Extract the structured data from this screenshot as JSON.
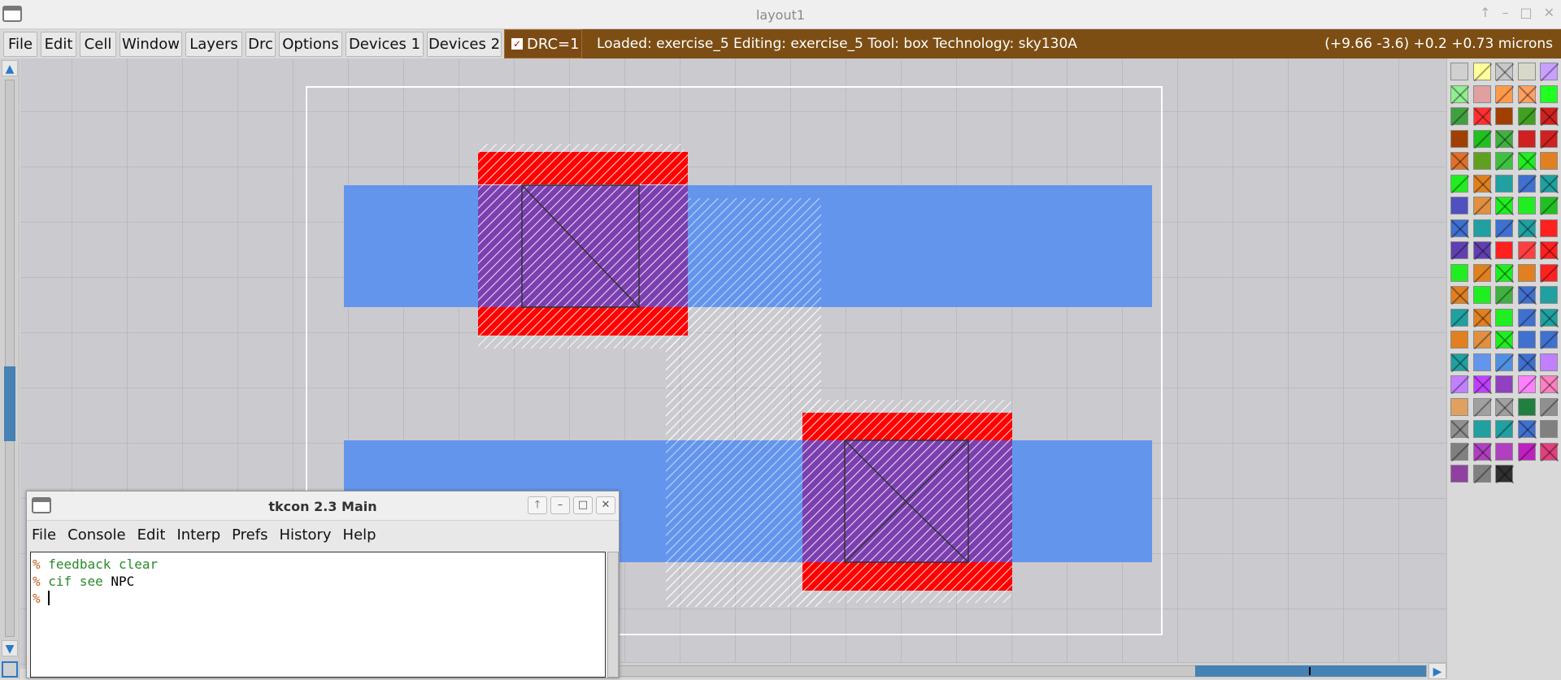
{
  "window": {
    "title": "layout1",
    "controls": [
      "↑",
      "–",
      "□",
      "✕"
    ]
  },
  "menubar": {
    "items": [
      "File",
      "Edit",
      "Cell",
      "Window",
      "Layers",
      "Drc",
      "Options",
      "Devices 1",
      "Devices 2"
    ]
  },
  "drc": {
    "label": "DRC=1",
    "checked": true
  },
  "status": {
    "text": "Loaded: exercise_5 Editing: exercise_5 Tool: box  Technology: sky130A",
    "coords": "(+9.66 -3.6) +0.2 +0.73 microns"
  },
  "canvas": {
    "colors": {
      "background": "#cacacf",
      "grid": "#a9a9b0",
      "metal_blue": "#6495ed",
      "poly_red": "#ff0000",
      "contact": "#6a3fa8",
      "outline": "#ffffff"
    }
  },
  "tkcon": {
    "title": "tkcon 2.3 Main",
    "controls": [
      "🡑",
      "–",
      "□",
      "✕"
    ],
    "menu": [
      "File",
      "Console",
      "Edit",
      "Interp",
      "Prefs",
      "History",
      "Help"
    ],
    "lines": [
      {
        "prompt": "%",
        "cmd": "feedback clear",
        "arg": ""
      },
      {
        "prompt": "%",
        "cmd": "cif see",
        "arg": "NPC"
      },
      {
        "prompt": "%",
        "cmd": "",
        "arg": ""
      }
    ]
  },
  "palette": {
    "icon": "layer-palette",
    "swatches": [
      "#d0d0d0",
      "#ffff9c",
      "#c8c8c8",
      "#d8d8c8",
      "#c8a0ff",
      "#90ee90",
      "#e0a0a0",
      "#ff9a4a",
      "#ffa060",
      "#20ff20",
      "#40a040",
      "#ff3030",
      "#a04000",
      "#40a020",
      "#d02020",
      "#a04000",
      "#20c020",
      "#40b040",
      "#d02020",
      "#d02020",
      "#e0702a",
      "#60a020",
      "#40c040",
      "#20ee20",
      "#e08020",
      "#20ee20",
      "#e08020",
      "#20a0a0",
      "#4070d0",
      "#20a0a0",
      "#5050c0",
      "#e09040",
      "#20ee20",
      "#20ee20",
      "#20c020",
      "#4070d0",
      "#20a0a0",
      "#4070d0",
      "#20a0a0",
      "#ff2020",
      "#6040b0",
      "#6040b0",
      "#ff2020",
      "#ff4040",
      "#ff2020",
      "#20ee20",
      "#e08020",
      "#20ee20",
      "#e08020",
      "#ff2020",
      "#e08020",
      "#20ee20",
      "#40b040",
      "#4070d0",
      "#20a0a0",
      "#20a0a0",
      "#e08020",
      "#20ee20",
      "#4070d0",
      "#20a0a0",
      "#e08020",
      "#e09040",
      "#20ee20",
      "#4070d0",
      "#4070d0",
      "#20a0a0",
      "#6495ed",
      "#5090e0",
      "#4070d0",
      "#c080ff",
      "#c080ff",
      "#c040ff",
      "#9040c0",
      "#ff80ff",
      "#ff80c0",
      "#e0a060",
      "#a0a0a0",
      "#a0a0a0",
      "#208040",
      "#909090",
      "#909090",
      "#20a0a0",
      "#20a0a0",
      "#4070d0",
      "#808080",
      "#808080",
      "#b040c0",
      "#b040c0",
      "#c020c0",
      "#e04080",
      "#9040a0",
      "#808080",
      "#303030"
    ]
  }
}
